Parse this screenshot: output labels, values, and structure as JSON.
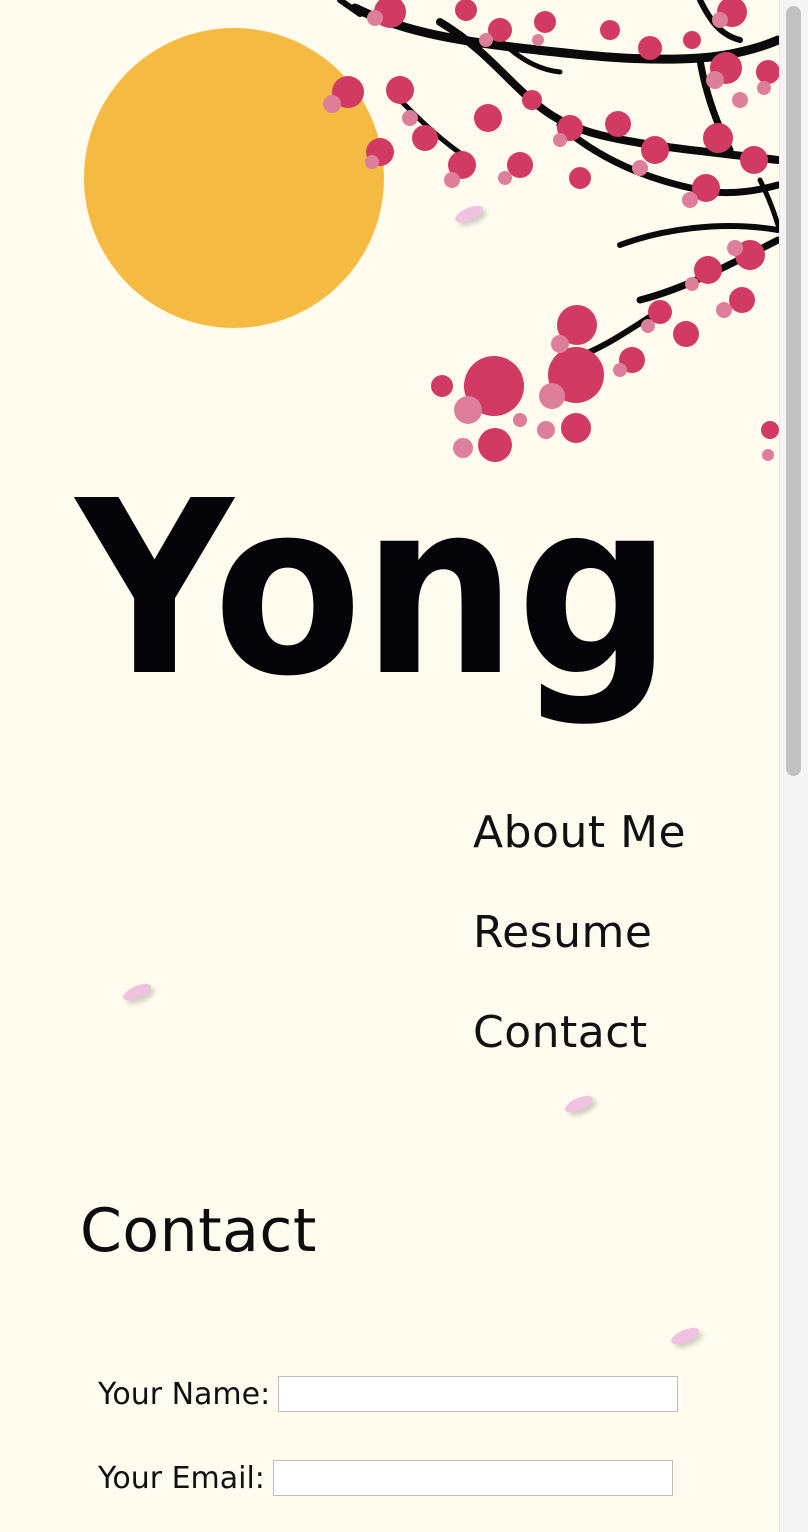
{
  "site": {
    "logo_text": "Yong"
  },
  "nav": {
    "items": [
      {
        "label": "About Me"
      },
      {
        "label": "Resume"
      },
      {
        "label": "Contact"
      }
    ]
  },
  "contact": {
    "title": "Contact",
    "name_label": "Your Name:",
    "name_value": "",
    "email_label": "Your Email:",
    "email_value": ""
  },
  "colors": {
    "background": "#fffcef",
    "sun": "#f5ba41",
    "blossom_dark": "#d13a63",
    "blossom_light": "#dd7f9a",
    "petal": "#f1c2df",
    "branch": "#0a0a0a",
    "text": "#111111"
  }
}
